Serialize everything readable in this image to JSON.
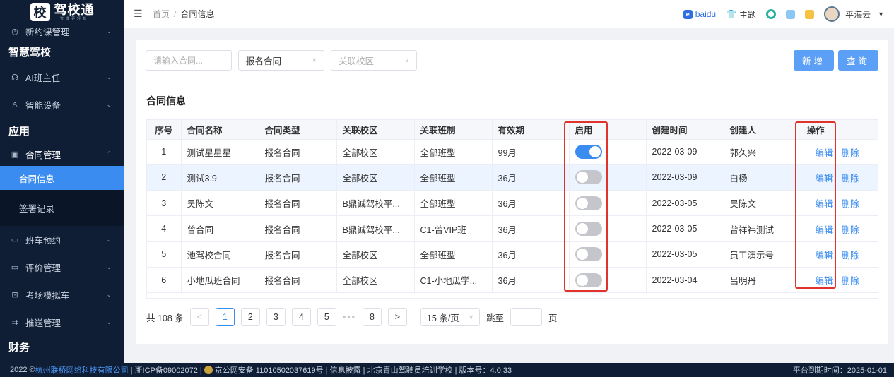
{
  "app": {
    "logo_char": "校",
    "logo_title": "驾校通",
    "logo_sub": "管理更轻松"
  },
  "sidebar": {
    "top_item": {
      "label": "新约课管理",
      "icon": "clock-icon"
    },
    "section1": "智慧驾校",
    "ai_item": {
      "label": "AI班主任",
      "icon": "headset-icon"
    },
    "device_item": {
      "label": "智能设备",
      "icon": "device-icon"
    },
    "section2": "应用",
    "contract_item": {
      "label": "合同管理",
      "icon": "contract-icon"
    },
    "sub_items": [
      {
        "label": "合同信息"
      },
      {
        "label": "签署记录"
      }
    ],
    "bus_item": {
      "label": "班车预约",
      "icon": "bus-icon"
    },
    "review_item": {
      "label": "评价管理",
      "icon": "comment-icon"
    },
    "sim_item": {
      "label": "考场模拟车",
      "icon": "car-icon"
    },
    "push_item": {
      "label": "推送管理",
      "icon": "push-icon"
    },
    "section3": "财务"
  },
  "header": {
    "breadcrumb_home": "首页",
    "breadcrumb_sep": "/",
    "breadcrumb_current": "合同信息",
    "baidu": "baidu",
    "theme": "主题",
    "user": "平海云"
  },
  "filters": {
    "search_placeholder": "请输入合同...",
    "type_value": "报名合同",
    "campus_placeholder": "关联校区",
    "add_label": "新增",
    "query_label": "查询"
  },
  "card_title": "合同信息",
  "table": {
    "headers": [
      "序号",
      "合同名称",
      "合同类型",
      "关联校区",
      "关联班制",
      "有效期",
      "启用",
      "创建时间",
      "创建人",
      "操作"
    ],
    "rows": [
      {
        "idx": "1",
        "name": "测试星星星",
        "type": "报名合同",
        "campus": "全部校区",
        "class": "全部班型",
        "valid": "99月",
        "enabled": true,
        "created": "2022-03-09",
        "creator": "郭久兴"
      },
      {
        "idx": "2",
        "name": "测试3.9",
        "type": "报名合同",
        "campus": "全部校区",
        "class": "全部班型",
        "valid": "36月",
        "enabled": false,
        "created": "2022-03-09",
        "creator": "白杨"
      },
      {
        "idx": "3",
        "name": "吴陈文",
        "type": "报名合同",
        "campus": "B鼎诚驾校平...",
        "class": "全部班型",
        "valid": "36月",
        "enabled": false,
        "created": "2022-03-05",
        "creator": "吴陈文"
      },
      {
        "idx": "4",
        "name": "曾合同",
        "type": "报名合同",
        "campus": "B鼎诚驾校平...",
        "class": "C1-曾VIP班",
        "valid": "36月",
        "enabled": false,
        "created": "2022-03-05",
        "creator": "曾祥祎测试"
      },
      {
        "idx": "5",
        "name": "池驾校合同",
        "type": "报名合同",
        "campus": "全部校区",
        "class": "全部班型",
        "valid": "36月",
        "enabled": false,
        "created": "2022-03-05",
        "creator": "员工演示号"
      },
      {
        "idx": "6",
        "name": "小地瓜班合同",
        "type": "报名合同",
        "campus": "全部校区",
        "class": "C1-小地瓜学...",
        "valid": "36月",
        "enabled": false,
        "created": "2022-03-04",
        "creator": "吕明丹"
      }
    ],
    "edit_label": "编辑",
    "delete_label": "删除"
  },
  "pager": {
    "total": "共 108 条",
    "pages": [
      "1",
      "2",
      "3",
      "4",
      "5"
    ],
    "dots": "•••",
    "last": "8",
    "size": "15 条/页",
    "jump_label": "跳至",
    "page_unit": "页"
  },
  "footer": {
    "copyright_prefix": "2022 ©",
    "company": "杭州联桥网络科技有限公司",
    "icp": "| 浙ICP备09002072 |",
    "police": "京公网安备 11010502037619号 | 信息披露 | 北京青山驾驶员培训学校  | 版本号：4.0.33",
    "expiry": "平台到期时间：2025-01-01"
  },
  "colors": {
    "accent": "#3a8cf0",
    "sidebar_bg": "#0f1e35",
    "highlight_box": "#e0332b"
  }
}
